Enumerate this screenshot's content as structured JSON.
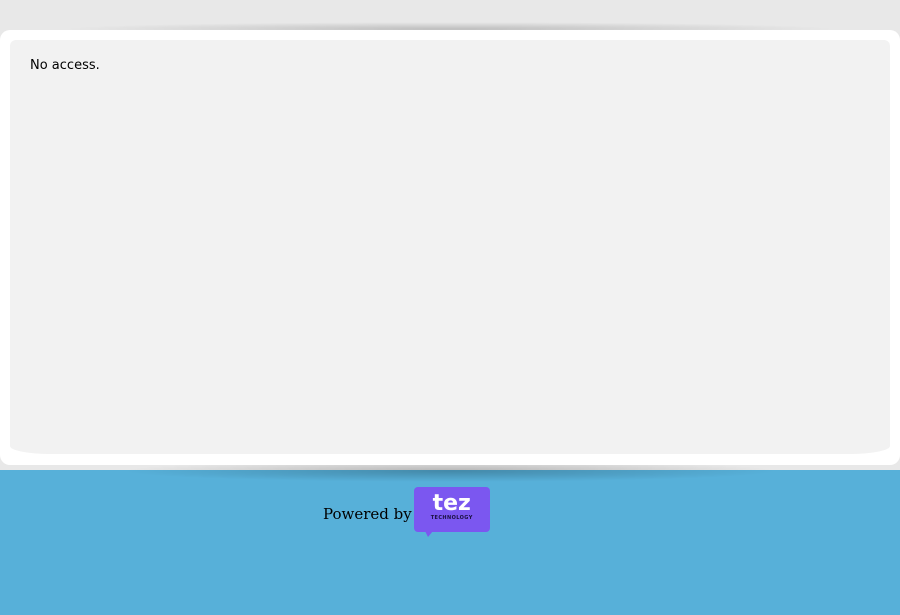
{
  "main": {
    "message": "No access."
  },
  "footer": {
    "powered_by_label": "Powered by",
    "logo": {
      "name": "tez",
      "tagline": "TECHNOLOGY"
    }
  },
  "colors": {
    "background_blue": "#57b0d9",
    "top_band": "#e8e8e8",
    "card": "#ffffff",
    "card_inner": "#f2f2f2",
    "logo_purple": "#7b57f0"
  }
}
